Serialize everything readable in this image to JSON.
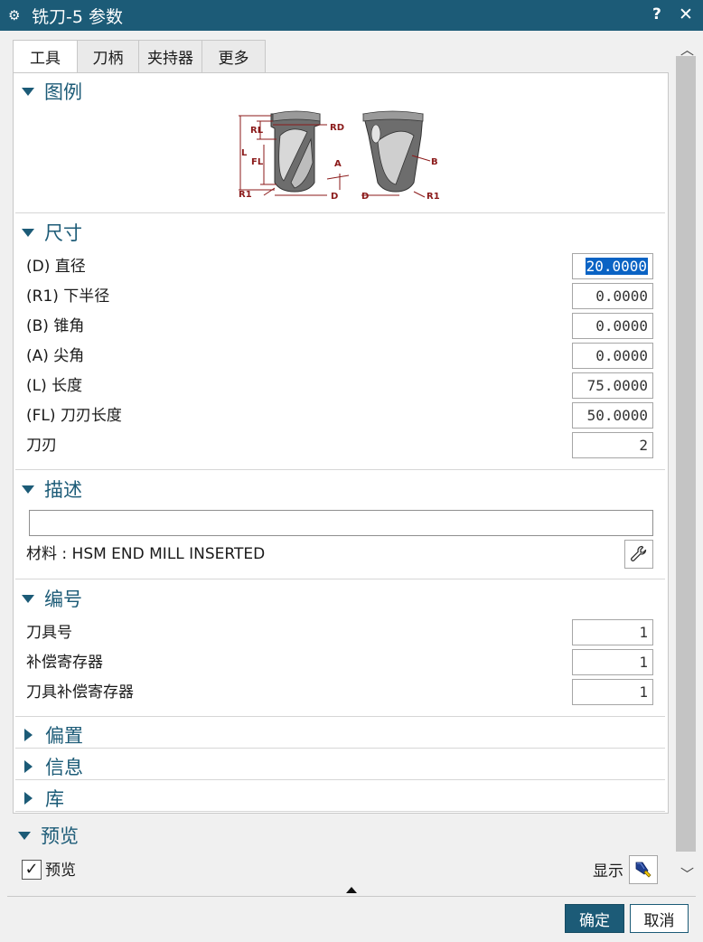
{
  "window": {
    "title": "铣刀-5 参数",
    "help_label": "?",
    "close_label": "✕",
    "title_icon": "gear-icon"
  },
  "tabs": [
    {
      "label": "工具",
      "active": true
    },
    {
      "label": "刀柄",
      "active": false
    },
    {
      "label": "夹持器",
      "active": false
    },
    {
      "label": "更多",
      "active": false
    }
  ],
  "sections": {
    "legend": {
      "title": "图例",
      "expanded": true
    },
    "dimensions": {
      "title": "尺寸",
      "expanded": true,
      "rows": [
        {
          "label": "(D) 直径",
          "value": "20.0000",
          "selected": true
        },
        {
          "label": "(R1) 下半径",
          "value": "0.0000"
        },
        {
          "label": "(B) 锥角",
          "value": "0.0000"
        },
        {
          "label": "(A) 尖角",
          "value": "0.0000"
        },
        {
          "label": "(L) 长度",
          "value": "75.0000"
        },
        {
          "label": "(FL) 刀刃长度",
          "value": "50.0000"
        },
        {
          "label": "刀刃",
          "value": "2"
        }
      ]
    },
    "description": {
      "title": "描述",
      "expanded": true,
      "value": "",
      "material": "材料 : HSM END MILL INSERTED",
      "material_icon": "wrench-icon"
    },
    "numbering": {
      "title": "编号",
      "expanded": true,
      "rows": [
        {
          "label": "刀具号",
          "value": "1"
        },
        {
          "label": "补偿寄存器",
          "value": "1"
        },
        {
          "label": "刀具补偿寄存器",
          "value": "1"
        }
      ]
    },
    "offset": {
      "title": "偏置",
      "expanded": false
    },
    "info": {
      "title": "信息",
      "expanded": false
    },
    "library": {
      "title": "库",
      "expanded": false
    },
    "preview": {
      "title": "预览",
      "expanded": true,
      "checkbox_label": "预览",
      "checked": true,
      "display_label": "显示",
      "display_icon": "flashlight-icon"
    }
  },
  "diagram_labels": {
    "rd": "RD",
    "rl": "RL",
    "l": "L",
    "fl": "FL",
    "r1": "R1",
    "a": "A",
    "d": "D",
    "b": "B"
  },
  "buttons": {
    "ok": "确定",
    "cancel": "取消"
  },
  "colors": {
    "title_bar": "#1c5b77",
    "accent": "#1c5b77",
    "dim_line": "#8b1a1a",
    "selection": "#0a63c4"
  }
}
